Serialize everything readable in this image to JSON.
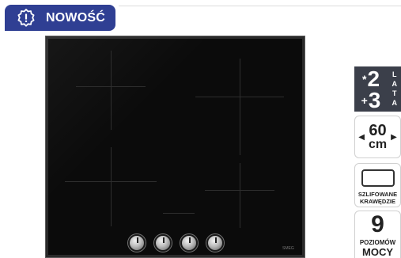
{
  "badge": {
    "label": "NOWOŚĆ",
    "icon": "alert-gear-icon",
    "color": "#2f3f93"
  },
  "product": {
    "image": "induction-hob",
    "brand": "SMEG",
    "knob_count": 4,
    "colors": {
      "glass": "#0b0b0b",
      "frame": "#5a5a5a"
    }
  },
  "features": {
    "warranty": {
      "row1_symbol": "*",
      "row1_value": "2",
      "row2_symbol": "+",
      "row2_value": "3",
      "unit_letters": [
        "L",
        "A",
        "T",
        "A"
      ],
      "bg": "#3b3f4a"
    },
    "width": {
      "value": "60",
      "unit": "cm",
      "icon_left": "arrow-left-icon",
      "icon_right": "arrow-right-icon"
    },
    "edges": {
      "line1": "SZLIFOWANE",
      "line2": "KRAWĘDZIE",
      "icon": "ground-edges-icon"
    },
    "power": {
      "value": "9",
      "line1": "POZIOMÓW",
      "line2": "MOCY"
    }
  }
}
